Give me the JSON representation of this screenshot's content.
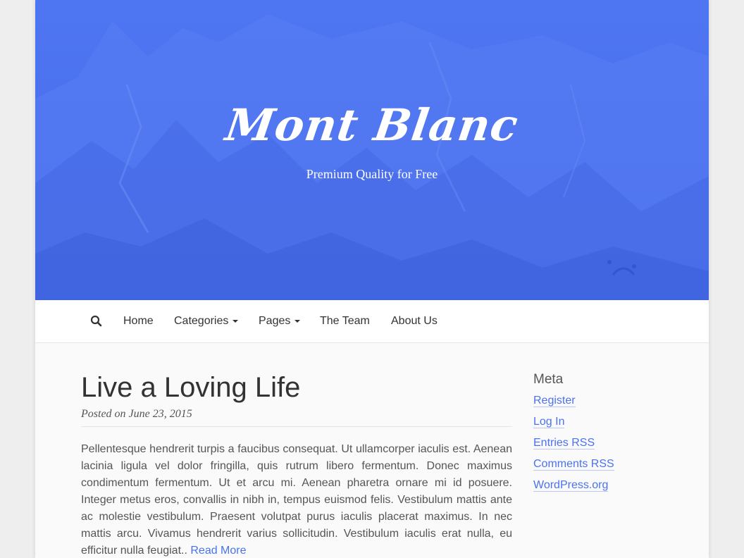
{
  "hero": {
    "title": "Mont Blanc",
    "tagline": "Premium Quality for Free",
    "background_color": "#4a72f0"
  },
  "nav": {
    "search_icon": "search-icon",
    "items": [
      {
        "label": "Home",
        "has_dropdown": false
      },
      {
        "label": "Categories",
        "has_dropdown": true
      },
      {
        "label": "Pages",
        "has_dropdown": true
      },
      {
        "label": "The Team",
        "has_dropdown": false
      },
      {
        "label": "About Us",
        "has_dropdown": false
      }
    ]
  },
  "post": {
    "title": "Live a Loving Life",
    "meta": "Posted on June 23, 2015",
    "excerpt": "Pellentesque hendrerit turpis a faucibus consequat. Ut ullamcorper iaculis est. Aenean lacinia ligula vel dolor fringilla, quis rutrum libero fermentum. Donec maximus condimentum fermentum. Ut et arcu mi. Aenean pharetra ornare mi id posuere. Integer metus eros, convallis in nibh in, tempus euismod felis. Vestibulum mattis ante ac molestie vestibulum. Praesent volutpat purus iaculis placerat maximus. In nec mattis arcu.  Vivamus hendrerit varius sollicitudin. Vestibulum iaculis erat nulla, eu efficitur nulla feugiat..",
    "read_more": "Read More"
  },
  "sidebar": {
    "widget_title": "Meta",
    "links": [
      {
        "label": "Register"
      },
      {
        "label": "Log In"
      },
      {
        "label": "Entries RSS"
      },
      {
        "label": "Comments RSS"
      },
      {
        "label": "WordPress.org"
      }
    ]
  },
  "colors": {
    "accent": "#4a72f0",
    "text": "#555555",
    "heading": "#333333"
  }
}
